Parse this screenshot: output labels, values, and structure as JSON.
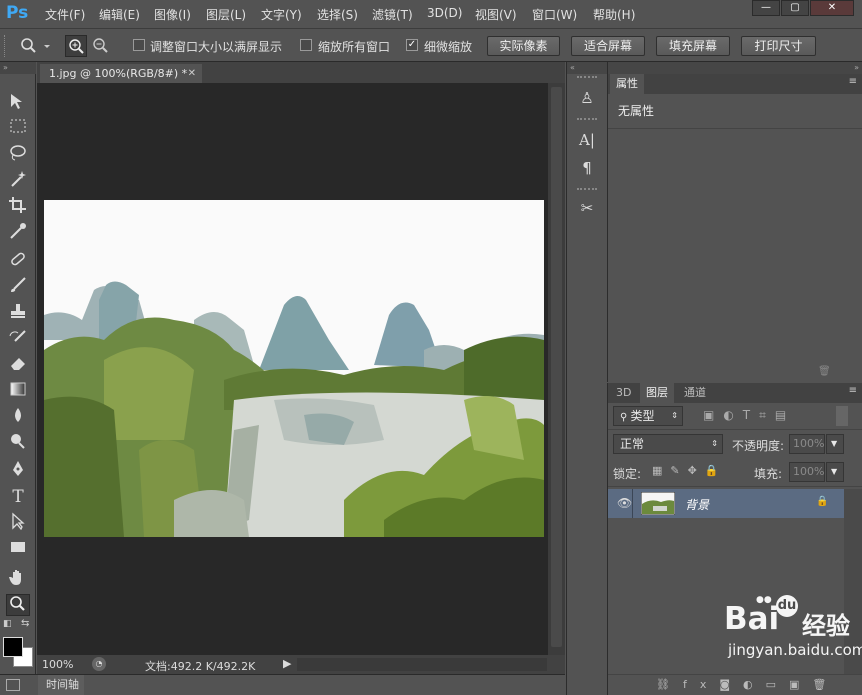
{
  "app": {
    "logo": "Ps"
  },
  "menu": [
    "文件(F)",
    "编辑(E)",
    "图像(I)",
    "图层(L)",
    "文字(Y)",
    "选择(S)",
    "滤镜(T)",
    "3D(D)",
    "视图(V)",
    "窗口(W)",
    "帮助(H)"
  ],
  "window_controls": {
    "minimize": "—",
    "restore": "▢",
    "close": "✕"
  },
  "options": {
    "resize_windows": {
      "label": "调整窗口大小以满屏显示",
      "checked": false
    },
    "zoom_all": {
      "label": "缩放所有窗口",
      "checked": false
    },
    "scrubby_zoom": {
      "label": "细微缩放",
      "checked": true
    },
    "buttons": [
      "实际像素",
      "适合屏幕",
      "填充屏幕",
      "打印尺寸"
    ]
  },
  "document": {
    "tab_title": "1.jpg @ 100%(RGB/8#) *",
    "zoom": "100%",
    "doc_info": "文档:492.2 K/492.2K"
  },
  "timeline": {
    "label": "时间轴"
  },
  "properties": {
    "tab": "属性",
    "content": "无属性"
  },
  "layers_panel": {
    "tabs": [
      "3D",
      "图层",
      "通道"
    ],
    "active_tab": "图层",
    "filter_kind": "类型",
    "blend_mode": "正常",
    "opacity_label": "不透明度:",
    "opacity_value": "100%",
    "lock_label": "锁定:",
    "fill_label": "填充:",
    "fill_value": "100%",
    "layers": [
      {
        "name": "背景",
        "visible": true,
        "locked": true
      }
    ]
  },
  "watermark": {
    "brand": "Bai",
    "brand2": "经验",
    "url": "jingyan.baidu.com"
  },
  "colors": {
    "accent": "#3fa9f5",
    "selected_layer": "#5b6b82",
    "canvas_bg": "#282828"
  }
}
